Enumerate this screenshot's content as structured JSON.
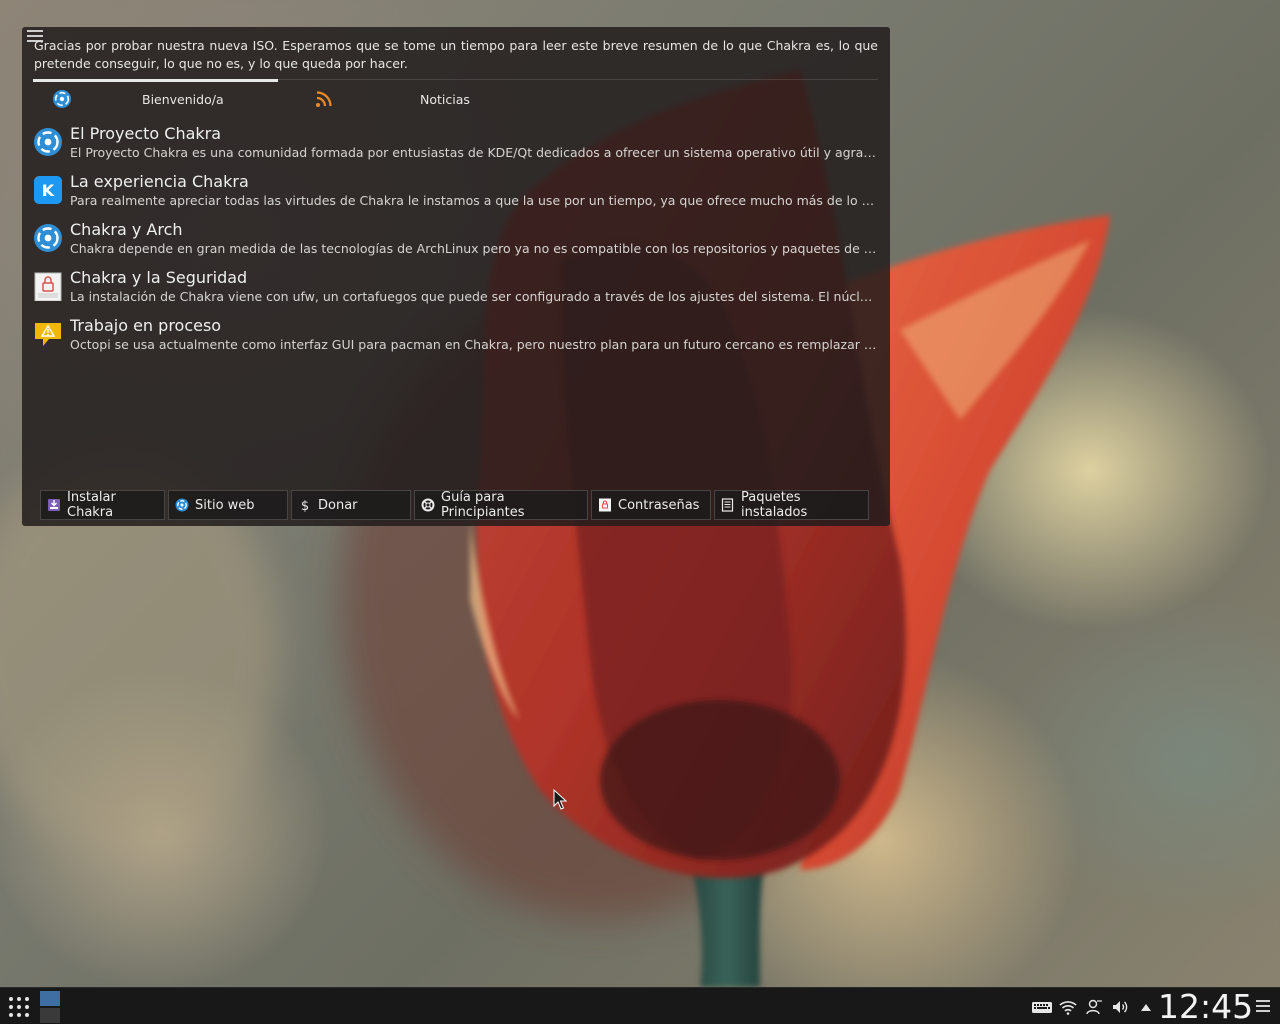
{
  "welcome": {
    "intro_text": "Gracias por probar nuestra nueva ISO. Esperamos que se tome un tiempo para leer este breve resumen de lo que Chakra es, lo que pretende conseguir, lo que no es, y lo que queda por hacer.",
    "tabs": [
      {
        "label": "Bienvenido/a",
        "icon": "chakra-logo-icon",
        "active": true
      },
      {
        "label": "Noticias",
        "icon": "rss-feed-icon",
        "active": false
      }
    ],
    "articles": [
      {
        "title": "El Proyecto Chakra",
        "body": "El Proyecto Chakra es una comunidad formada por entusiastas de KDE/Qt dedicados a ofrecer un sistema operativo útil y agradable",
        "icon": "chakra-logo-icon"
      },
      {
        "title": "La experiencia Chakra",
        "body": "Para realmente apreciar todas las virtudes de Chakra le instamos a que la use por un tiempo, ya que ofrece mucho más de lo que parece",
        "icon": "kde-logo-icon"
      },
      {
        "title": "Chakra y Arch",
        "body": "Chakra depende en gran medida de las tecnologías de ArchLinux pero ya no es compatible con los repositorios y paquetes de ArchLinux",
        "icon": "chakra-logo-icon"
      },
      {
        "title": "Chakra y la Seguridad",
        "body": "La instalación de Chakra viene con ufw, un cortafuegos que puede ser configurado a través de los ajustes del sistema. El núcleo se actualiza",
        "icon": "security-lock-icon"
      },
      {
        "title": "Trabajo en proceso",
        "body": "Octopi se usa actualmente como interfaz GUI para pacman en Chakra, pero nuestro plan para un futuro cercano es remplazar pacman",
        "icon": "warning-icon"
      }
    ],
    "buttons": [
      {
        "label": "Instalar Chakra",
        "icon": "install-icon"
      },
      {
        "label": "Sitio web",
        "icon": "chakra-logo-icon"
      },
      {
        "label": "Donar",
        "icon": "dollar-icon"
      },
      {
        "label": "Guía para Principiantes",
        "icon": "help-lifebuoy-icon"
      },
      {
        "label": "Contraseñas",
        "icon": "password-lock-icon"
      },
      {
        "label": "Paquetes instalados",
        "icon": "package-list-icon"
      }
    ]
  },
  "taskbar": {
    "clock": "12:45",
    "tray_icons": [
      "keyboard-icon",
      "wifi-icon",
      "user-icon",
      "volume-icon",
      "expand-tray-icon"
    ],
    "pager": {
      "desktops": 2,
      "active_desktop": 1
    }
  },
  "colors": {
    "chakra_blue": "#2e8fd6",
    "rss_orange": "#f08a24",
    "warning_yellow": "#f2b807",
    "pager_active": "#3e6ea2"
  }
}
